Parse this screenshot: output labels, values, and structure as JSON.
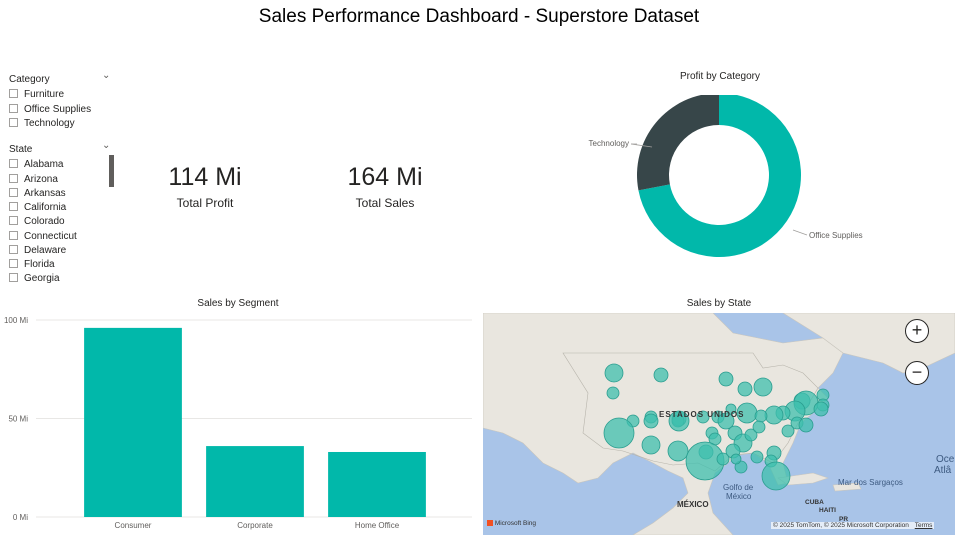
{
  "title": "Sales Performance Dashboard - Superstore Dataset",
  "category_slicer": {
    "header": "Category",
    "options": [
      "Furniture",
      "Office Supplies",
      "Technology"
    ]
  },
  "state_slicer": {
    "header": "State",
    "options": [
      "Alabama",
      "Arizona",
      "Arkansas",
      "California",
      "Colorado",
      "Connecticut",
      "Delaware",
      "Florida",
      "Georgia"
    ]
  },
  "kpis": [
    {
      "value": "114 Mi",
      "label": "Total Profit"
    },
    {
      "value": "164 Mi",
      "label": "Total Sales"
    }
  ],
  "donut": {
    "title": "Profit by Category",
    "labels": [
      "Technology",
      "Office Supplies"
    ]
  },
  "map": {
    "title": "Sales by State",
    "country_label": "ESTADOS UNIDOS",
    "labels": [
      "Golfo de",
      "México",
      "MÉXICO",
      "Mar dos Sargaços",
      "Oce",
      "Atlâ",
      "CUBA",
      "HAITI",
      "PR"
    ],
    "bing_logo": "Microsoft Bing",
    "attribution": "© 2025 TomTom, © 2025 Microsoft Corporation",
    "terms": "Terms",
    "zoom_in": "+",
    "zoom_out": "−",
    "bubble_color": "#3fbfad"
  },
  "colors": {
    "teal": "#01b8aa",
    "dark": "#374649"
  },
  "chart_data": [
    {
      "type": "pie",
      "title": "Profit by Category",
      "labels": [
        "Office Supplies",
        "Technology"
      ],
      "values": [
        72,
        28
      ]
    },
    {
      "type": "bar",
      "title": "Sales by Segment",
      "categories": [
        "Consumer",
        "Corporate",
        "Home Office"
      ],
      "values": [
        96,
        36,
        33
      ],
      "ylim": [
        0,
        100
      ],
      "yticks": [
        "0 Mi",
        "50 Mi",
        "100 Mi"
      ],
      "ytick_values": [
        0,
        50,
        100
      ],
      "grid": true
    }
  ]
}
